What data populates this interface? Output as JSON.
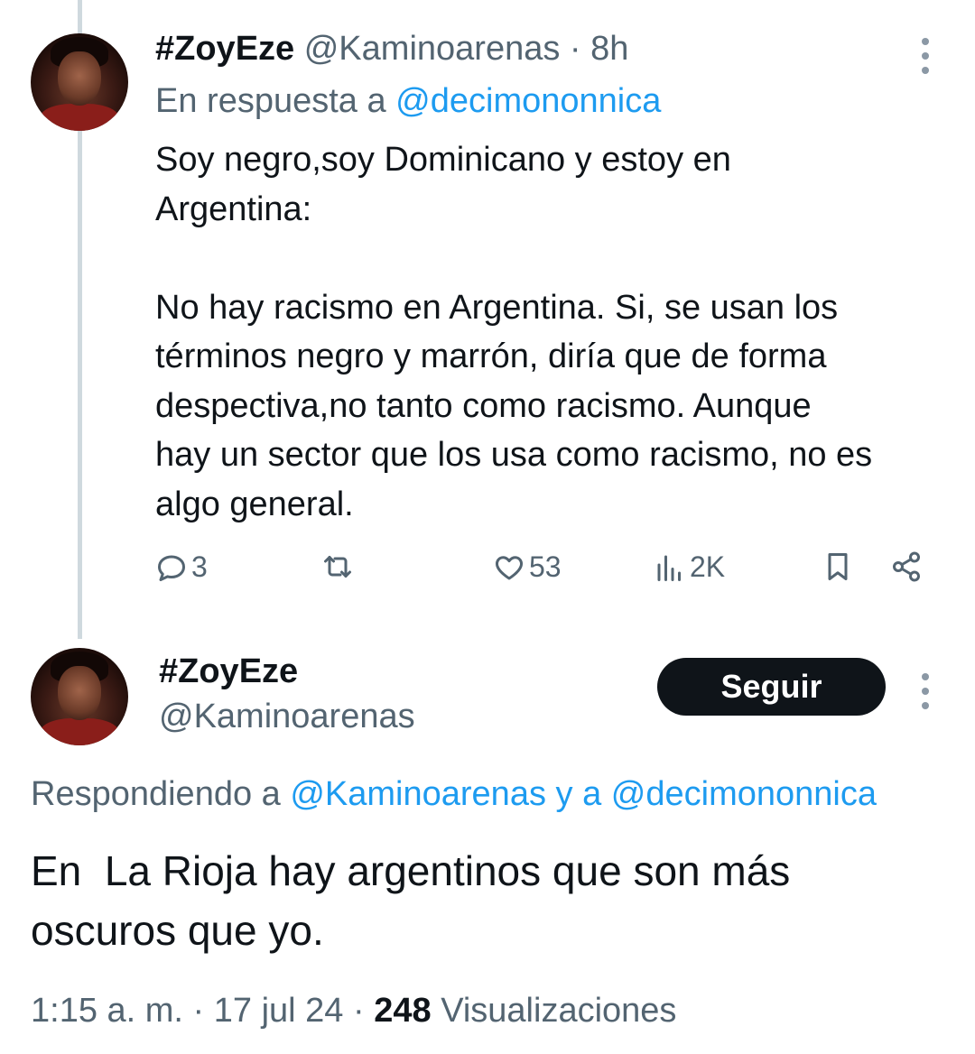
{
  "parent_tweet": {
    "display_name": "#ZoyEze",
    "handle": "@Kaminoarenas",
    "time": "8h",
    "reply_prefix": "En respuesta a",
    "reply_to": "@decimononnica",
    "text": "Soy negro,soy Dominicano y estoy en\nArgentina:\n\nNo hay racismo en Argentina. Si, se usan los\ntérminos negro y marrón, diría que de forma\ndespectiva,no tanto como racismo. Aunque\nhay un sector que los usa como racismo, no es\nalgo general.",
    "actions": {
      "replies": "3",
      "likes": "53",
      "views": "2K"
    }
  },
  "main_tweet": {
    "display_name": "#ZoyEze",
    "handle": "@Kaminoarenas",
    "follow_label": "Seguir",
    "replying_prefix": "Respondiendo a",
    "replying_to_1": "@Kaminoarenas",
    "replying_joiner": "y a",
    "replying_to_2": "@decimononnica",
    "text": "En  La Rioja hay argentinos que son más\noscuros que yo.",
    "time": "1:15 a. m.",
    "date": "17 jul 24",
    "views_count": "248",
    "views_label": "Visualizaciones"
  },
  "colors": {
    "link": "#1d9bf0",
    "muted": "#536471",
    "text": "#0f1419",
    "thread_line": "#cfd9de"
  },
  "icons": [
    "reply-icon",
    "retweet-icon",
    "like-icon",
    "views-icon",
    "bookmark-icon",
    "share-icon",
    "more-icon"
  ]
}
